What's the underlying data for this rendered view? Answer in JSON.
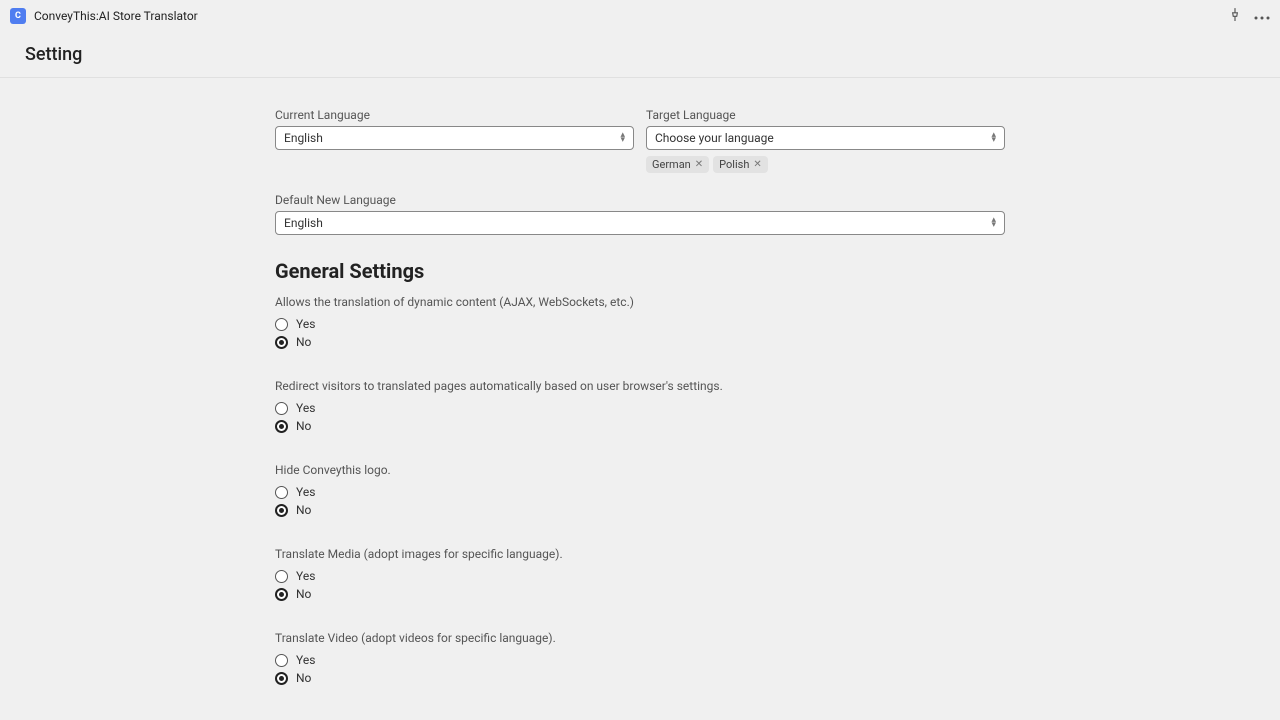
{
  "app": {
    "icon_text": "C",
    "title": "ConveyThis:AI Store Translator"
  },
  "header": {
    "title": "Setting"
  },
  "languages": {
    "current_label": "Current Language",
    "current_value": "English",
    "target_label": "Target Language",
    "target_placeholder": "Choose your language",
    "tags": [
      "German",
      "Polish"
    ],
    "default_label": "Default New Language",
    "default_value": "English"
  },
  "general": {
    "title": "General Settings",
    "options": {
      "yes": "Yes",
      "no": "No"
    },
    "settings": [
      {
        "label": "Allows the translation of dynamic content (AJAX, WebSockets, etc.)",
        "value": "no"
      },
      {
        "label": "Redirect visitors to translated pages automatically based on user browser's settings.",
        "value": "no"
      },
      {
        "label": "Hide Conveythis logo.",
        "value": "no"
      },
      {
        "label": "Translate Media (adopt images for specific language).",
        "value": "no"
      },
      {
        "label": "Translate Video (adopt videos for specific language).",
        "value": "no"
      }
    ]
  }
}
